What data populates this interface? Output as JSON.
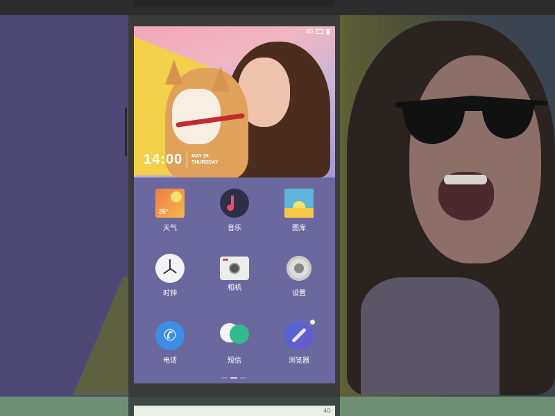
{
  "status_bar": {
    "network": "4G"
  },
  "lockscreen": {
    "time": "14:00",
    "date_line1": "MAY 26",
    "date_line2": "THURSDAY"
  },
  "apps": [
    {
      "label": "天气",
      "icon": "weather-icon",
      "extra": "26°"
    },
    {
      "label": "音乐",
      "icon": "music-icon"
    },
    {
      "label": "图库",
      "icon": "gallery-icon"
    },
    {
      "label": "时钟",
      "icon": "clock-icon"
    },
    {
      "label": "相机",
      "icon": "camera-icon"
    },
    {
      "label": "设置",
      "icon": "settings-icon"
    },
    {
      "label": "电话",
      "icon": "phone-icon"
    },
    {
      "label": "短信",
      "icon": "sms-icon"
    },
    {
      "label": "浏览器",
      "icon": "browser-icon"
    }
  ],
  "page_indicator": {
    "pages": 3,
    "current": 2
  },
  "next_screen": {
    "network": "4G"
  },
  "colors": {
    "screen_bg": "#6b68a0",
    "left_panel": "#4e4876",
    "bottom_band": "#6f8f74"
  }
}
